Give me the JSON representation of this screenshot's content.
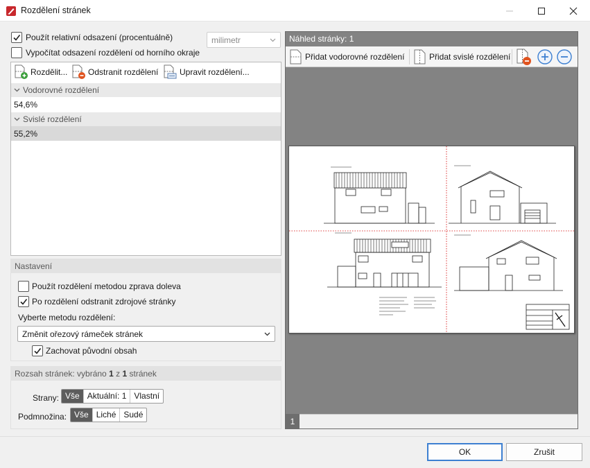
{
  "window": {
    "title": "Rozdělení stránek"
  },
  "options": {
    "relative_offset_label": "Použít relativní odsazení (procentuálně)",
    "relative_offset_checked": true,
    "calc_from_top_label": "Vypočítat odsazení rozdělení od horního okraje",
    "calc_from_top_checked": false,
    "unit_value": "milimetr"
  },
  "toolbar": {
    "split_label": "Rozdělit...",
    "remove_label": "Odstranit rozdělení",
    "edit_label": "Upravit rozdělení..."
  },
  "splits": {
    "horizontal_header": "Vodorovné rozdělení",
    "horizontal_values": [
      "54,6%"
    ],
    "vertical_header": "Svislé rozdělení",
    "vertical_values": [
      "55,2%"
    ]
  },
  "settings": {
    "header": "Nastavení",
    "right_to_left_label": "Použít rozdělení metodou zprava doleva",
    "right_to_left_checked": false,
    "remove_source_label": "Po rozdělení odstranit zdrojové stránky",
    "remove_source_checked": true,
    "method_label": "Vyberte metodu rozdělení:",
    "method_value": "Změnit ořezový rámeček stránek",
    "keep_content_label": "Zachovat původní obsah",
    "keep_content_checked": true
  },
  "range": {
    "header_prefix": "Rozsah stránek: vybráno ",
    "selected": "1",
    "header_mid": " z ",
    "total": "1",
    "header_suffix": " stránek",
    "pages_label": "Strany:",
    "pages_options": [
      "Vše",
      "Aktuální: 1",
      "Vlastní"
    ],
    "pages_selected": "Vše",
    "subset_label": "Podmnožina:",
    "subset_options": [
      "Vše",
      "Liché",
      "Sudé"
    ],
    "subset_selected": "Vše"
  },
  "preview": {
    "header": "Náhled stránky: 1",
    "add_horizontal_label": "Přidat vodorovné rozdělení",
    "add_vertical_label": "Přidat svislé rozdělení",
    "page_tab": "1"
  },
  "buttons": {
    "ok": "OK",
    "cancel": "Zrušit"
  },
  "colors": {
    "accent": "#3c7fd1",
    "split_line": "#d40000",
    "add_green": "#3a9e3a",
    "remove_red": "#e0531f"
  }
}
